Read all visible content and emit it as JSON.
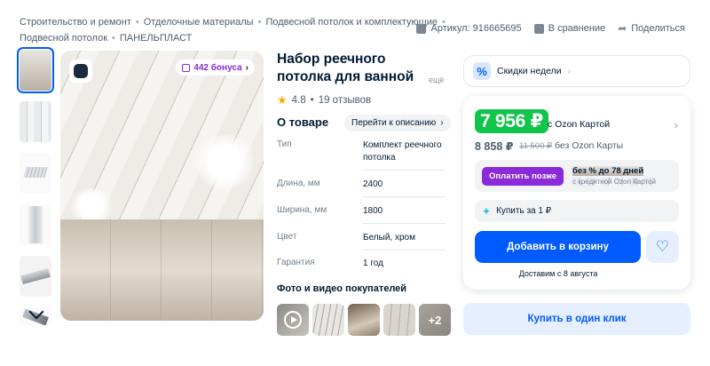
{
  "breadcrumbs": {
    "row1": [
      "Строительство и ремонт",
      "Отделочные материалы",
      "Подвесной потолок и комплектующие"
    ],
    "row2": [
      "Подвесной потолок",
      "ПАНЕЛЬПЛАСТ"
    ]
  },
  "top_actions": {
    "sku": "Артикул: 916665695",
    "compare": "В сравнение",
    "share": "Поделиться"
  },
  "gallery": {
    "bonus": "442 бонуса",
    "thumbnails_count": 6
  },
  "product": {
    "title": "Набор реечного потолка для ванной",
    "more": "ещё",
    "rating": "4.8",
    "reviews": "19 отзывов"
  },
  "about": {
    "heading": "О товаре",
    "goto_label": "Перейти к описанию",
    "specs": [
      {
        "key": "Тип",
        "value": "Комплект реечного потолка"
      },
      {
        "key": "Длина, мм",
        "value": "2400"
      },
      {
        "key": "Ширина, мм",
        "value": "1800"
      },
      {
        "key": "Цвет",
        "value": "Белый, хром"
      },
      {
        "key": "Гарантия",
        "value": "1 год"
      }
    ]
  },
  "ugc": {
    "heading": "Фото и видео покупателей",
    "more_count": "+2"
  },
  "deals": {
    "week_label": "Скидки недели"
  },
  "price": {
    "card_price": "7 956 ₽",
    "card_label": "с Ozon Картой",
    "regular_price": "8 858 ₽",
    "old_price": "11 500 ₽",
    "no_card_label": "без Ozon Карты",
    "pay_later_button": "Оплатить позже",
    "pay_later_title": "без % до 78 дней",
    "pay_later_sub": "с кредитной Ozon Картой",
    "buy_for_one": "Купить за 1 ₽",
    "add_to_cart": "Добавить в корзину",
    "delivery": "Доставим с 8 августа",
    "one_click": "Купить в один клик"
  },
  "colors": {
    "accent": "#005bff",
    "green_price": "#10c44c",
    "purple": "#8a2ad8",
    "star": "#ffa800"
  }
}
